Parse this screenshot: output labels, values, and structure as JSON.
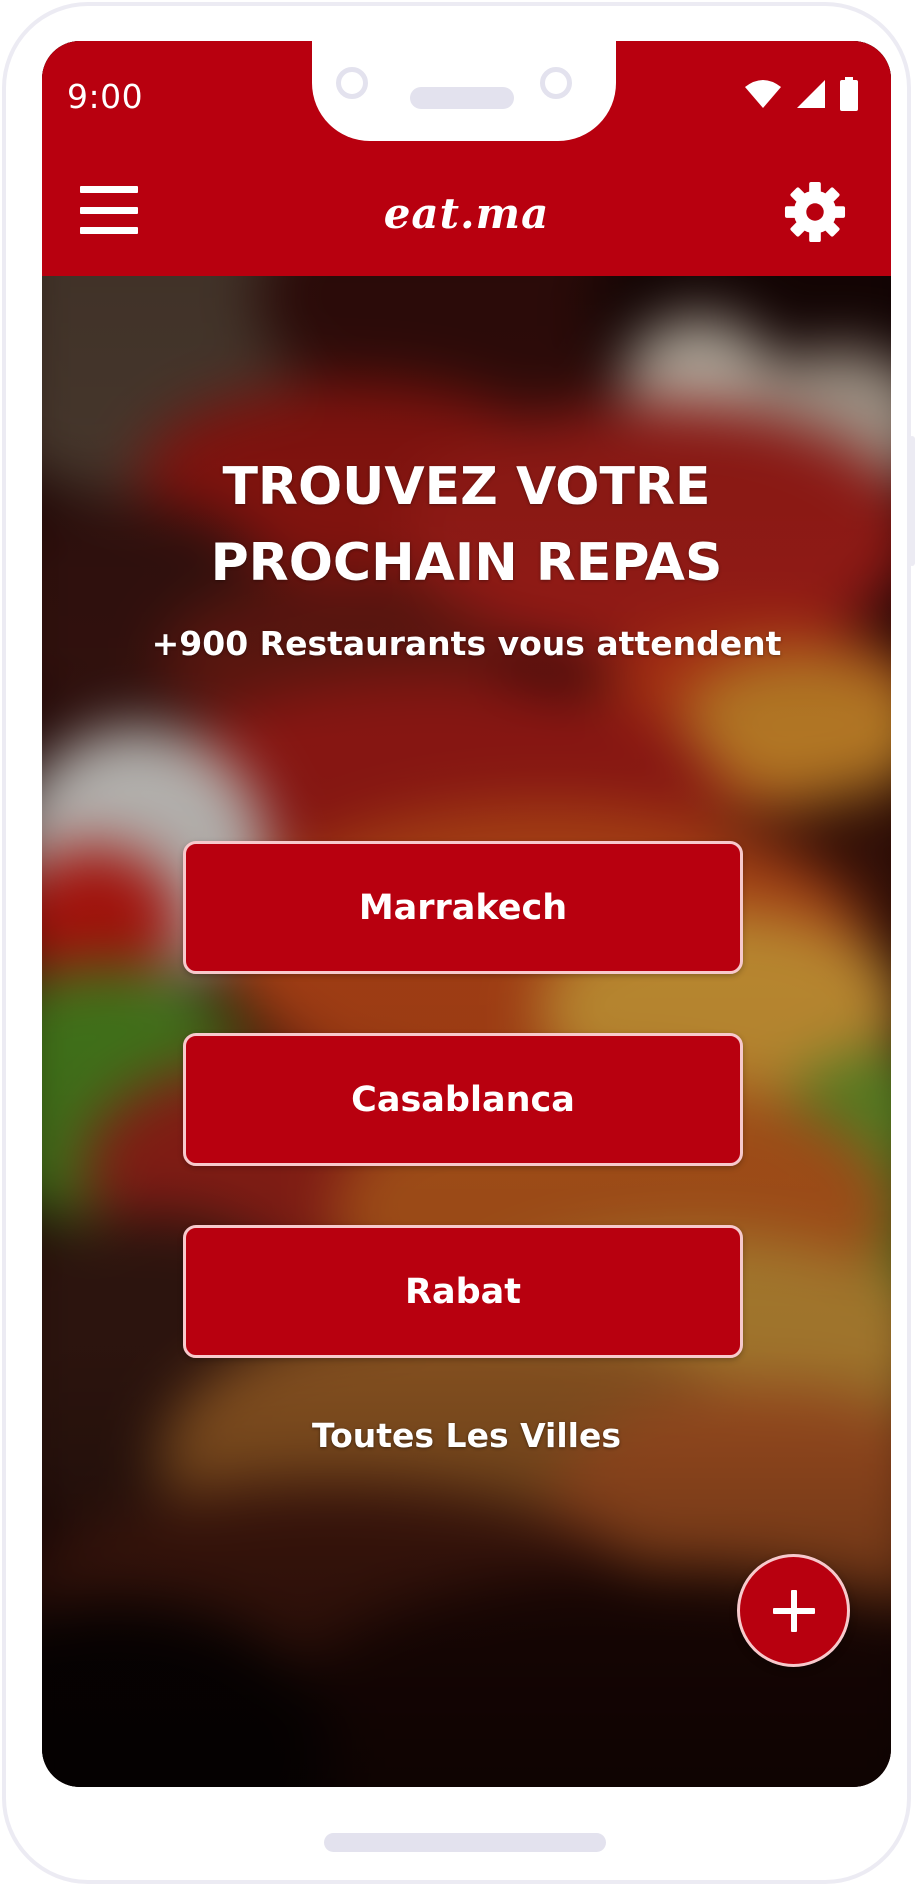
{
  "status_bar": {
    "time": "9:00",
    "icons": [
      "wifi-icon",
      "signal-icon",
      "battery-icon"
    ]
  },
  "app_bar": {
    "brand": "eat.ma",
    "menu_icon": "hamburger-menu-icon",
    "settings_icon": "gear-icon"
  },
  "hero": {
    "title": "TROUVEZ VOTRE PROCHAIN REPAS",
    "subtitle": "+900 Restaurants vous attendent"
  },
  "cities": [
    {
      "label": "Marrakech"
    },
    {
      "label": "Casablanca"
    },
    {
      "label": "Rabat"
    }
  ],
  "all_cities_link": "Toutes Les Villes",
  "fab": {
    "icon": "plus-icon"
  },
  "colors": {
    "primary": "#b8000f",
    "button_border": "#f7c9cc",
    "text": "#ffffff",
    "device_frame": "#ecebf3"
  }
}
